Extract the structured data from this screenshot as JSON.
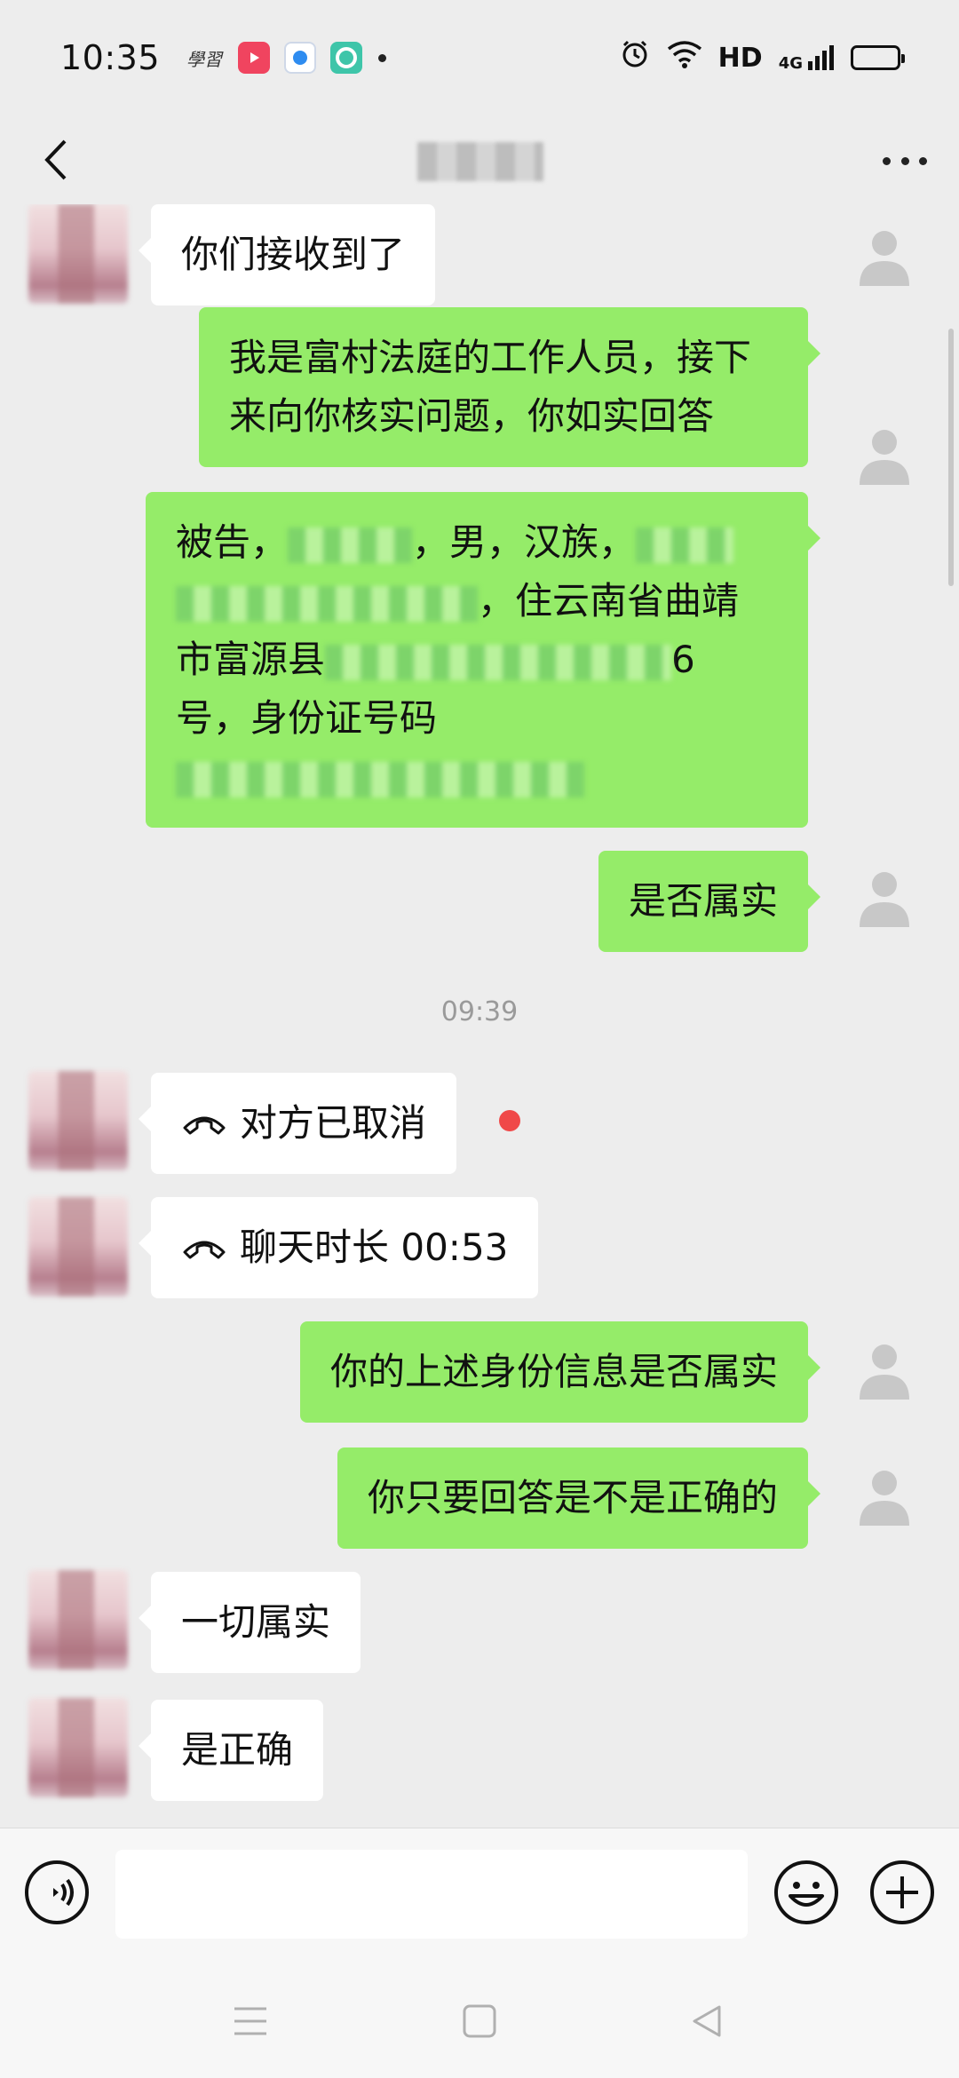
{
  "status_bar": {
    "time": "10:35",
    "app_label": "學習",
    "network": "HD",
    "cell": "4G"
  },
  "header": {
    "title": ""
  },
  "messages": [
    {
      "side": "left",
      "text": "你们接收到了"
    },
    {
      "side": "right",
      "text": "我是富村法庭的工作人员，接下来向你核实问题，你如实回答"
    },
    {
      "side": "right",
      "parts": {
        "p1": "被告，",
        "p2": "，男，汉族，",
        "p3": "，住云南省曲靖",
        "p4": "市富源县",
        "p5": "6",
        "p6": "号，身份证号码"
      }
    },
    {
      "side": "right",
      "text": "是否属实"
    },
    {
      "type": "time",
      "text": "09:39"
    },
    {
      "side": "left",
      "type": "call",
      "text": "对方已取消"
    },
    {
      "side": "left",
      "type": "call",
      "text": "聊天时长 00:53"
    },
    {
      "side": "right",
      "text": "你的上述身份信息是否属实"
    },
    {
      "side": "right",
      "text": "你只要回答是不是正确的"
    },
    {
      "side": "left",
      "text": "一切属实"
    },
    {
      "side": "left",
      "text": "是正确"
    }
  ],
  "input": {
    "placeholder": ""
  },
  "icons": {
    "back": "chevron-left-icon",
    "more": "more-dots-icon",
    "voice": "voice-input-icon",
    "emoji": "emoji-icon",
    "plus": "plus-icon",
    "call": "phone-hangup-icon",
    "avatar_default": "person-silhouette-icon"
  },
  "colors": {
    "background": "#ededed",
    "bubble_self": "#95ec69",
    "bubble_other": "#ffffff",
    "unread": "#f04848"
  }
}
